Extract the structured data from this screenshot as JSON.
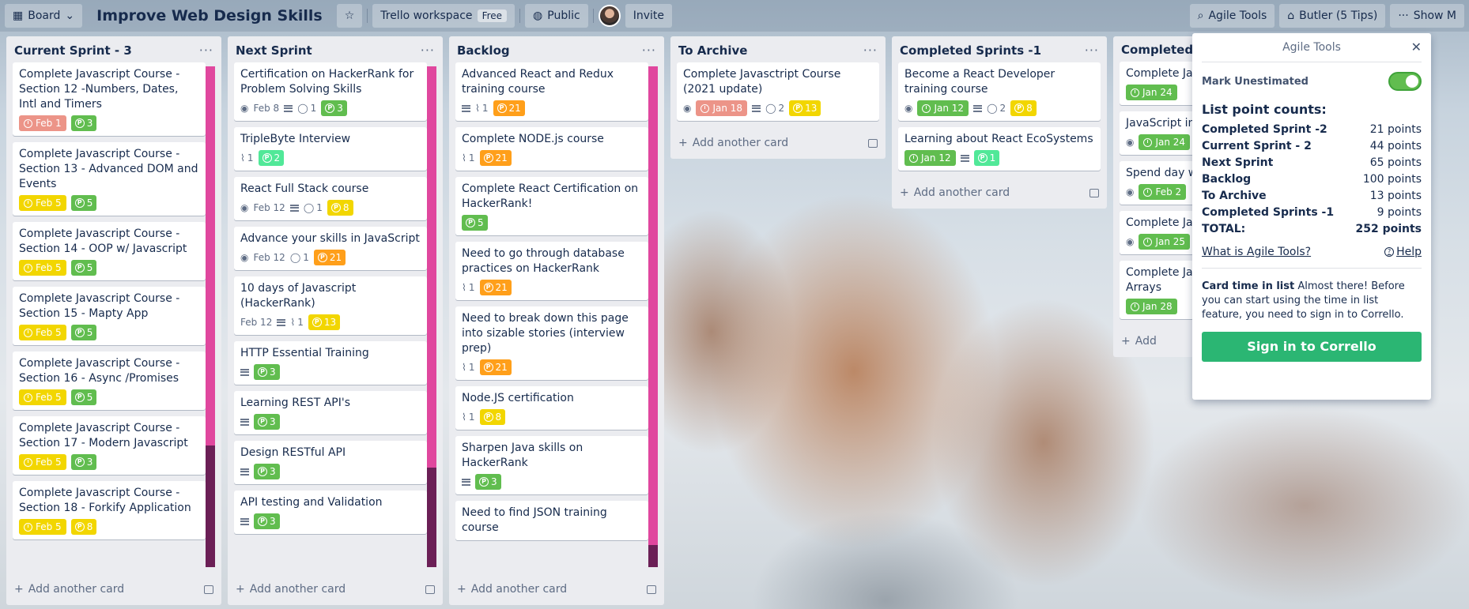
{
  "topbar": {
    "board_menu": "Board",
    "board_title": "Improve Web Design Skills",
    "workspace": "Trello workspace",
    "workspace_badge": "Free",
    "visibility": "Public",
    "invite": "Invite",
    "agile_tools": "Agile Tools",
    "butler": "Butler (5 Tips)",
    "show_menu": "Show M"
  },
  "lists": [
    {
      "title": "Current Sprint - 3",
      "add_card": "Add another card",
      "cards": [
        {
          "title": "Complete Javascript Course - Section 12 -Numbers, Dates, Intl and Timers",
          "due": "Feb 1",
          "points": "3"
        },
        {
          "title": "Complete Javascript Course - Section 13 - Advanced DOM and Events",
          "due": "Feb 5",
          "points": "5"
        },
        {
          "title": "Complete Javascript Course - Section 14 - OOP w/ Javascript",
          "due": "Feb 5",
          "points": "5"
        },
        {
          "title": "Complete Javascript Course - Section 15 - Mapty App",
          "due": "Feb 5",
          "points": "5"
        },
        {
          "title": "Complete Javascript Course - Section 16 - Async /Promises",
          "due": "Feb 5",
          "points": "5"
        },
        {
          "title": "Complete Javascript Course - Section 17 - Modern Javascript",
          "due": "Feb 5",
          "points": "3"
        },
        {
          "title": "Complete Javascript Course - Section 18 - Forkify Application",
          "due": "Feb 5",
          "points": "8"
        }
      ]
    },
    {
      "title": "Next Sprint",
      "add_card": "Add another card",
      "cards": [
        {
          "title": "Certification on HackerRank for Problem Solving Skills",
          "due": "Feb 8",
          "comments": "1",
          "points": "3"
        },
        {
          "title": "TripleByte Interview",
          "attachments": "1",
          "points": "2"
        },
        {
          "title": "React Full Stack course",
          "due": "Feb 12",
          "comments": "1",
          "points": "8"
        },
        {
          "title": "Advance your skills in JavaScript",
          "due": "Feb 12",
          "comments": "1",
          "points": "21"
        },
        {
          "title": "10 days of Javascript (HackerRank)",
          "due": "Feb 12",
          "attachments": "1",
          "points": "13"
        },
        {
          "title": "HTTP Essential Training",
          "points": "3"
        },
        {
          "title": "Learning REST API's",
          "points": "3"
        },
        {
          "title": "Design RESTful API",
          "points": "3"
        },
        {
          "title": "API testing and Validation",
          "points": "3"
        }
      ]
    },
    {
      "title": "Backlog",
      "add_card": "Add another card",
      "cards": [
        {
          "title": "Advanced React and Redux training course",
          "attachments": "1",
          "points": "21"
        },
        {
          "title": "Complete NODE.js course",
          "attachments": "1",
          "points": "21"
        },
        {
          "title": "Complete React Certification on HackerRank!",
          "points": "5"
        },
        {
          "title": "Need to go through database practices on HackerRank",
          "attachments": "1",
          "points": "21"
        },
        {
          "title": "Need to break down this page into sizable stories (interview prep)",
          "attachments": "1",
          "points": "21"
        },
        {
          "title": "Node.JS certification",
          "attachments": "1",
          "points": "8"
        },
        {
          "title": "Sharpen Java skills on HackerRank",
          "points": "3"
        },
        {
          "title": "Need to find JSON training course"
        }
      ]
    },
    {
      "title": "To Archive",
      "add_card": "Add another card",
      "cards": [
        {
          "title": "Complete Javasctript Course (2021 update)",
          "due": "Jan 18",
          "comments": "2",
          "points": "13"
        }
      ]
    },
    {
      "title": "Completed Sprints -1",
      "add_card": "Add another card",
      "cards": [
        {
          "title": "Become a React Developer training course",
          "due": "Jan 12",
          "comments": "2",
          "points": "8"
        },
        {
          "title": "Learning about React EcoSystems",
          "due": "Jan 12",
          "points": "1"
        }
      ]
    },
    {
      "title": "Completed",
      "add_card": "Add",
      "cards": [
        {
          "title": "Complete Jav Section 9 - Da",
          "due": "Jan 24"
        },
        {
          "title": "JavaScript int",
          "due": "Jan 24"
        },
        {
          "title": "Spend day w",
          "due": "Feb 2"
        },
        {
          "title": "Complete Jav Section 10 - F",
          "due": "Jan 25"
        },
        {
          "title": "Complete Jav Section 11 - W Arrays",
          "due": "Jan 28"
        }
      ]
    }
  ],
  "agile_panel": {
    "title": "Agile Tools",
    "mark_unestimated": "Mark Unestimated",
    "counts_title": "List point counts:",
    "counts": [
      {
        "name": "Completed Sprint -2",
        "points": "21 points"
      },
      {
        "name": "Current Sprint - 2",
        "points": "44 points"
      },
      {
        "name": "Next Sprint",
        "points": "65 points"
      },
      {
        "name": "Backlog",
        "points": "100 points"
      },
      {
        "name": "To Archive",
        "points": "13 points"
      },
      {
        "name": "Completed Sprints -1",
        "points": "9 points"
      },
      {
        "name": "TOTAL:",
        "points": "252 points"
      }
    ],
    "what_is": "What is Agile Tools?",
    "help": "Help",
    "cit_bold": "Card time in list",
    "cit_rest": " Almost there! Before you can start using the time in list feature, you need to sign in to Corrello.",
    "signin": "Sign in to Corrello"
  }
}
